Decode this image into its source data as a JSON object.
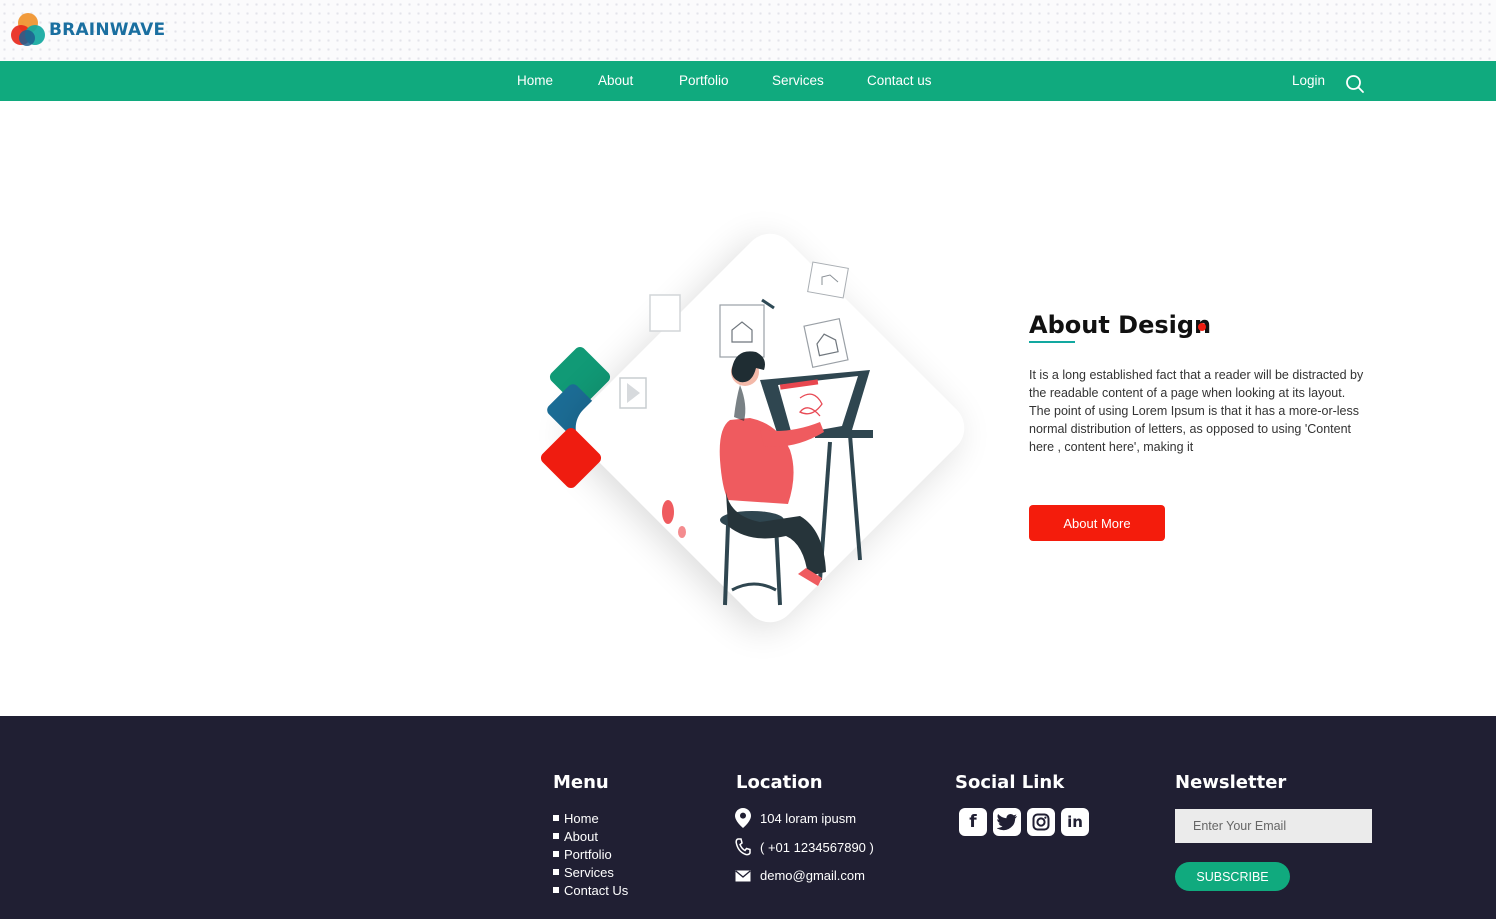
{
  "brand": {
    "name": "BRAINWAVE"
  },
  "nav": {
    "items": [
      {
        "label": "Home"
      },
      {
        "label": "About"
      },
      {
        "label": "Portfolio"
      },
      {
        "label": "Services"
      },
      {
        "label": "Contact us"
      }
    ],
    "login": "Login",
    "search_icon": "search-icon"
  },
  "about": {
    "title": "About Design",
    "body": "It is a long established fact that a reader will be distracted by the readable content of a page when looking at its layout. The point of using Lorem Ipsum is that it has a more-or-less normal distribution of letters, as opposed to using 'Content here , content here', making it",
    "button": "About More"
  },
  "footer": {
    "menu": {
      "heading": "Menu",
      "items": [
        "Home",
        "About",
        "Portfolio",
        "Services",
        "Contact Us"
      ]
    },
    "location": {
      "heading": "Location",
      "address": "104 loram ipusm",
      "phone": "( +01 1234567890 )",
      "email": "demo@gmail.com"
    },
    "social": {
      "heading": "Social Link",
      "icons": [
        "facebook-icon",
        "twitter-icon",
        "instagram-icon",
        "linkedin-icon"
      ]
    },
    "newsletter": {
      "heading": "Newsletter",
      "placeholder": "Enter Your Email",
      "button": "SUBSCRIBE"
    }
  },
  "colors": {
    "primary": "#10aa7e",
    "accent": "#f41c0c",
    "footer_bg": "#201f33",
    "brand_text": "#1a6fa0"
  }
}
